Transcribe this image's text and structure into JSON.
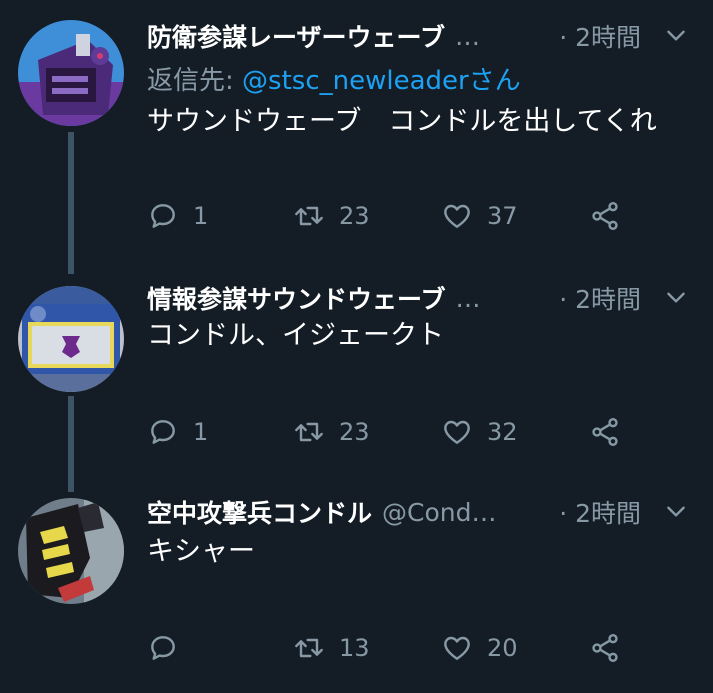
{
  "colors": {
    "background": "#141d26",
    "name": "#ffffff",
    "secondary": "#8899a6",
    "link": "#1da1f2",
    "thread_line": "#3d5466"
  },
  "tweets": [
    {
      "name": "防衛参謀レーザーウェーブ",
      "handle": "…",
      "time": "· 2時間",
      "reply_label": "返信先:",
      "reply_mention": "@stsc_newleaderさん",
      "text": "サウンドウェーブ　コンドルを出してくれ",
      "replies": "1",
      "retweets": "23",
      "likes": "37"
    },
    {
      "name": "情報参謀サウンドウェーブ",
      "handle": "…",
      "time": "· 2時間",
      "text": "コンドル、イジェークト",
      "replies": "1",
      "retweets": "23",
      "likes": "32"
    },
    {
      "name": "空中攻撃兵コンドル",
      "handle": "@Cond…",
      "time": "· 2時間",
      "text": "キシャー",
      "replies": "",
      "retweets": "13",
      "likes": "20"
    }
  ],
  "icons": [
    "reply-icon",
    "retweet-icon",
    "like-icon",
    "share-icon",
    "chevron-down-icon",
    "avatar-image"
  ]
}
